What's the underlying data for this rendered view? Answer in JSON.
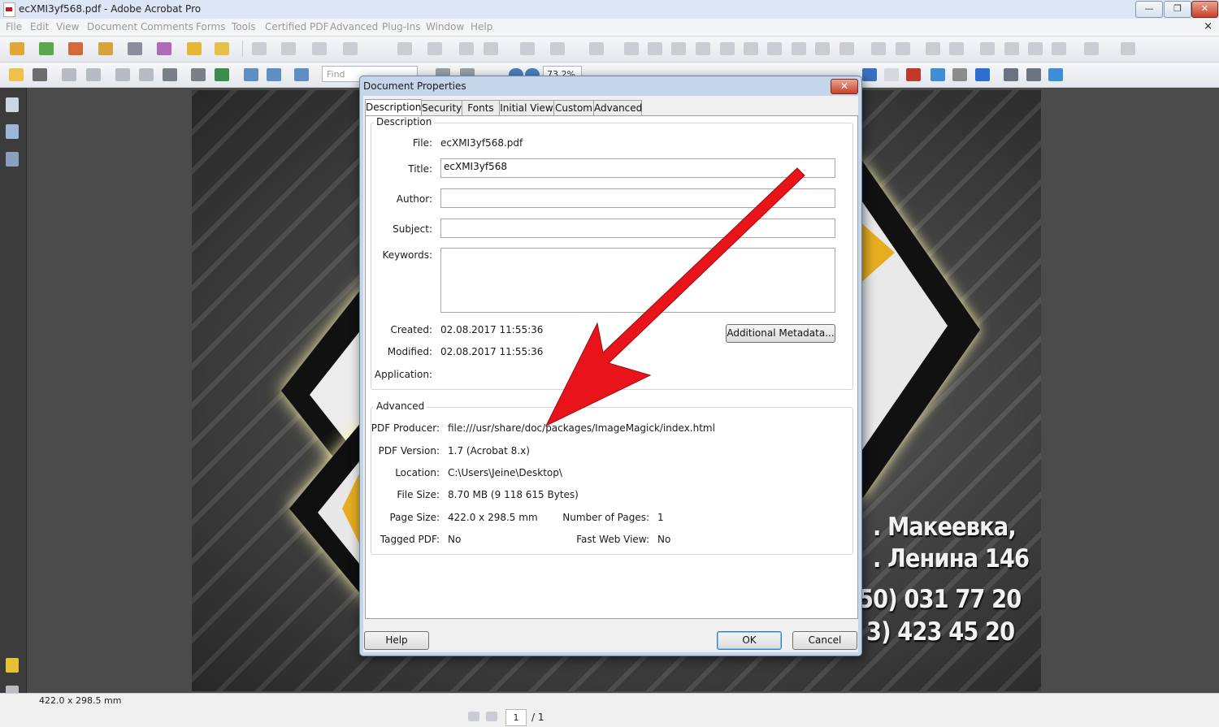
{
  "window": {
    "title": "ecXMI3yf568.pdf - Adobe Acrobat Pro",
    "minimize": "—",
    "restore": "❐",
    "close": "✕",
    "doc_close": "×"
  },
  "menu": [
    "File",
    "Edit",
    "View",
    "Document",
    "Comments",
    "Forms",
    "Tools",
    "Certified PDF",
    "Advanced",
    "Plug-Ins",
    "Window",
    "Help"
  ],
  "toolbar": {
    "find_placeholder": "Find",
    "zoom": "73.2%"
  },
  "page_content": {
    "lines": [
      "г. Макеевка,",
      "ул. Ленина 146",
      "(050) 031 77 20",
      "(063) 423 45 20"
    ],
    "visible_lines": [
      ". Макеевка,",
      ". Ленина 146",
      "50) 031 77 20",
      "3) 423 45 20"
    ]
  },
  "dialog": {
    "title": "Document Properties",
    "close": "✕",
    "tabs": [
      "Description",
      "Security",
      "Fonts",
      "Initial View",
      "Custom",
      "Advanced"
    ],
    "active_tab": "Description",
    "description": {
      "group_label": "Description",
      "file_label": "File:",
      "file_value": "ecXMI3yf568.pdf",
      "title_label": "Title:",
      "title_value": "ecXMI3yf568",
      "author_label": "Author:",
      "author_value": "",
      "subject_label": "Subject:",
      "subject_value": "",
      "keywords_label": "Keywords:",
      "keywords_value": "",
      "created_label": "Created:",
      "created_value": "02.08.2017 11:55:36",
      "modified_label": "Modified:",
      "modified_value": "02.08.2017 11:55:36",
      "application_label": "Application:",
      "application_value": "",
      "metadata_button": "Additional Metadata..."
    },
    "advanced": {
      "group_label": "Advanced",
      "producer_label": "PDF Producer:",
      "producer_value": "file:///usr/share/doc/packages/ImageMagick/index.html",
      "version_label": "PDF Version:",
      "version_value": "1.7 (Acrobat 8.x)",
      "location_label": "Location:",
      "location_value": "C:\\Users\\Jeine\\Desktop\\",
      "filesize_label": "File Size:",
      "filesize_value": "8.70 MB (9 118 615 Bytes)",
      "pagesize_label": "Page Size:",
      "pagesize_value": "422.0 x 298.5 mm",
      "numpages_label": "Number of Pages:",
      "numpages_value": "1",
      "tagged_label": "Tagged PDF:",
      "tagged_value": "No",
      "fastweb_label": "Fast Web View:",
      "fastweb_value": "No"
    },
    "buttons": {
      "help": "Help",
      "ok": "OK",
      "cancel": "Cancel"
    }
  },
  "status": {
    "page_size": "422.0 x 298.5 mm",
    "current_page": "1",
    "total_pages": "/ 1"
  },
  "colors": {
    "annotation_arrow": "#e8141a",
    "dialog_frame": "#c5d6ea",
    "default_button_glow": "#7ec3f2"
  },
  "icons": [
    "pdf-file-icon",
    "red-arrow-annotation",
    "pages-panel-icon",
    "bookmarks-icon",
    "signatures-icon",
    "comments-icon",
    "attachments-icon"
  ]
}
